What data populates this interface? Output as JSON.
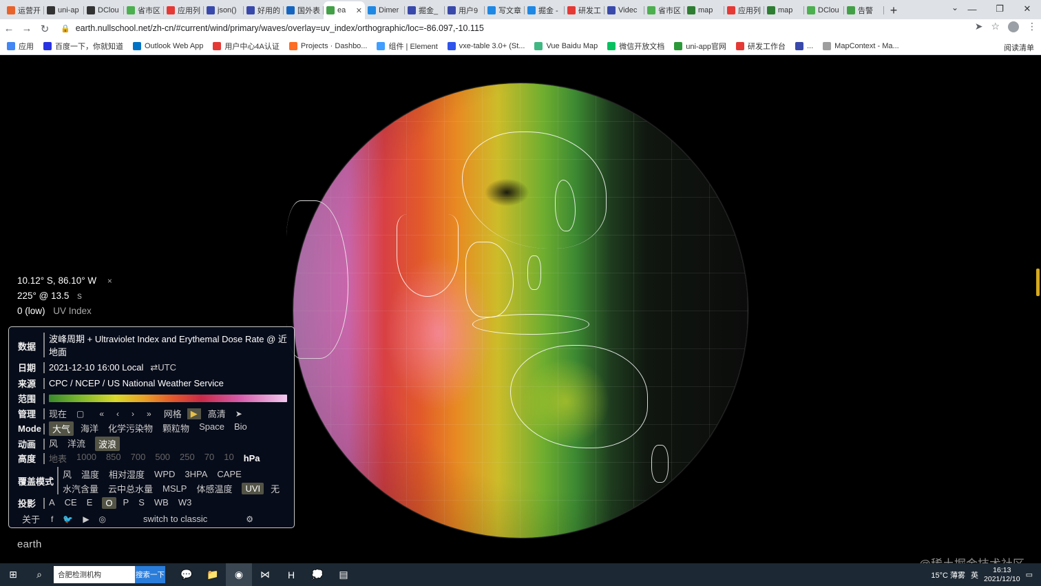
{
  "browser": {
    "tabs": [
      {
        "title": "运营开",
        "color": "#e8632b"
      },
      {
        "title": "uni-ap",
        "color": "#333333"
      },
      {
        "title": "DClou",
        "color": "#333333"
      },
      {
        "title": "省市区",
        "color": "#4caf50"
      },
      {
        "title": "应用列",
        "color": "#e53935"
      },
      {
        "title": "json()",
        "color": "#3949ab"
      },
      {
        "title": "好用的",
        "color": "#3949ab"
      },
      {
        "title": "国外表",
        "color": "#1565c0"
      },
      {
        "title": "ea",
        "color": "#43a047",
        "active": true
      },
      {
        "title": "Dimer",
        "color": "#1e88e5"
      },
      {
        "title": "掘金_",
        "color": "#3949ab"
      },
      {
        "title": "用户9",
        "color": "#3949ab"
      },
      {
        "title": "写文章",
        "color": "#1e88e5"
      },
      {
        "title": "掘金 -",
        "color": "#1e88e5"
      },
      {
        "title": "研发工",
        "color": "#e53935"
      },
      {
        "title": "Videc",
        "color": "#3949ab"
      },
      {
        "title": "省市区",
        "color": "#4caf50"
      },
      {
        "title": "map",
        "color": "#2e7d32"
      },
      {
        "title": "应用列",
        "color": "#e53935"
      },
      {
        "title": "map",
        "color": "#2e7d32"
      },
      {
        "title": "DClou",
        "color": "#4caf50"
      },
      {
        "title": "告警",
        "color": "#43a047"
      }
    ],
    "new_tab": "+",
    "tab_search": "⌄",
    "window": {
      "minimize": "—",
      "maximize": "❐",
      "close": "✕"
    },
    "nav": {
      "back": "←",
      "forward": "→",
      "reload": "↻"
    },
    "url": "earth.nullschool.net/zh-cn/#current/wind/primary/waves/overlay=uv_index/orthographic/loc=-86.097,-10.115",
    "lock": "🔒",
    "toolbar_icons": {
      "send": "➤",
      "star": "☆",
      "menu": "⋮"
    },
    "bookmarks": [
      {
        "label": "应用",
        "color": "#4285f4"
      },
      {
        "label": "百度一下，你就知道",
        "color": "#2932e1"
      },
      {
        "label": "Outlook Web App",
        "color": "#0072c6"
      },
      {
        "label": "用户中心4A认证",
        "color": "#e53935"
      },
      {
        "label": "Projects · Dashbo...",
        "color": "#fc6d26"
      },
      {
        "label": "组件 | Element",
        "color": "#409eff"
      },
      {
        "label": "vxe-table 3.0+ (St...",
        "color": "#2f54eb"
      },
      {
        "label": "Vue Baidu Map",
        "color": "#41b883"
      },
      {
        "label": "微信开放文档",
        "color": "#07c160"
      },
      {
        "label": "uni-app官网",
        "color": "#2b9939"
      },
      {
        "label": "研发工作台",
        "color": "#e53935"
      },
      {
        "label": "...",
        "color": "#3949ab"
      },
      {
        "label": "MapContext - Ma...",
        "color": "#9e9e9e"
      }
    ],
    "reading_list": "阅读清单"
  },
  "readout": {
    "location": "10.12° S, 86.10° W",
    "close": "×",
    "wind": "225° @ 13.5",
    "wind_unit": "s",
    "uvi": "0 (low)",
    "uvi_label": "UV Index"
  },
  "panel": {
    "data_label": "数据",
    "data_value": "波峰周期 + Ultraviolet Index and Erythemal Dose Rate @ 近地面",
    "date_label": "日期",
    "date_value": "2021-12-10 16:00 Local",
    "date_toggle": "⇄UTC",
    "source_label": "来源",
    "source_value": "CPC / NCEP / US National Weather Service",
    "scale_label": "范围",
    "control_label": "管理",
    "control": {
      "now": "现在",
      "calendar": "▢",
      "back2": "«",
      "back1": "‹",
      "fwd1": "›",
      "fwd2": "»",
      "grid": "网格",
      "play": "▶",
      "hd": "高清",
      "locate": "➤"
    },
    "mode_label": "Mode",
    "modes": [
      "大气",
      "海洋",
      "化学污染物",
      "颗粒物",
      "Space",
      "Bio"
    ],
    "mode_selected": 0,
    "anim_label": "动画",
    "anims": [
      "风",
      "洋流",
      "波浪"
    ],
    "anim_selected": 2,
    "height_label": "高度",
    "heights": [
      "地表",
      "1000",
      "850",
      "700",
      "500",
      "250",
      "70",
      "10"
    ],
    "height_unit": "hPa",
    "overlay_label": "覆盖模式",
    "overlays_row1": [
      "风",
      "温度",
      "相对湿度",
      "WPD",
      "3HPA",
      "CAPE"
    ],
    "overlays_row2": [
      "水汽含量",
      "云中总水量",
      "MSLP",
      "体感温度",
      "UVI",
      "无"
    ],
    "overlay_selected": "UVI",
    "proj_label": "投影",
    "projections": [
      "A",
      "CE",
      "E",
      "O",
      "P",
      "S",
      "WB",
      "W3"
    ],
    "proj_selected": "O",
    "about": "关于",
    "social": {
      "facebook": "f",
      "twitter": "🐦",
      "youtube": "▶",
      "instagram": "◎"
    },
    "classic": "switch to classic",
    "settings": "⚙"
  },
  "earth_link": "earth",
  "watermark": "@稀土掘金技术社区",
  "taskbar": {
    "start": "⊞",
    "search_icon": "⌕",
    "search_text": "合肥检测机构",
    "search_button": "搜索一下",
    "apps": [
      "💬",
      "📁",
      "◉",
      "⋈",
      "H",
      "💭",
      "▤"
    ],
    "weather": "15°C 薄雾",
    "ime": "英",
    "time": "16:13",
    "date": "2021/12/10",
    "notification": "▭"
  },
  "colors": {
    "accent": "#e8c048",
    "panel_bg": "#080e1e",
    "selected_bg": "#545446"
  }
}
